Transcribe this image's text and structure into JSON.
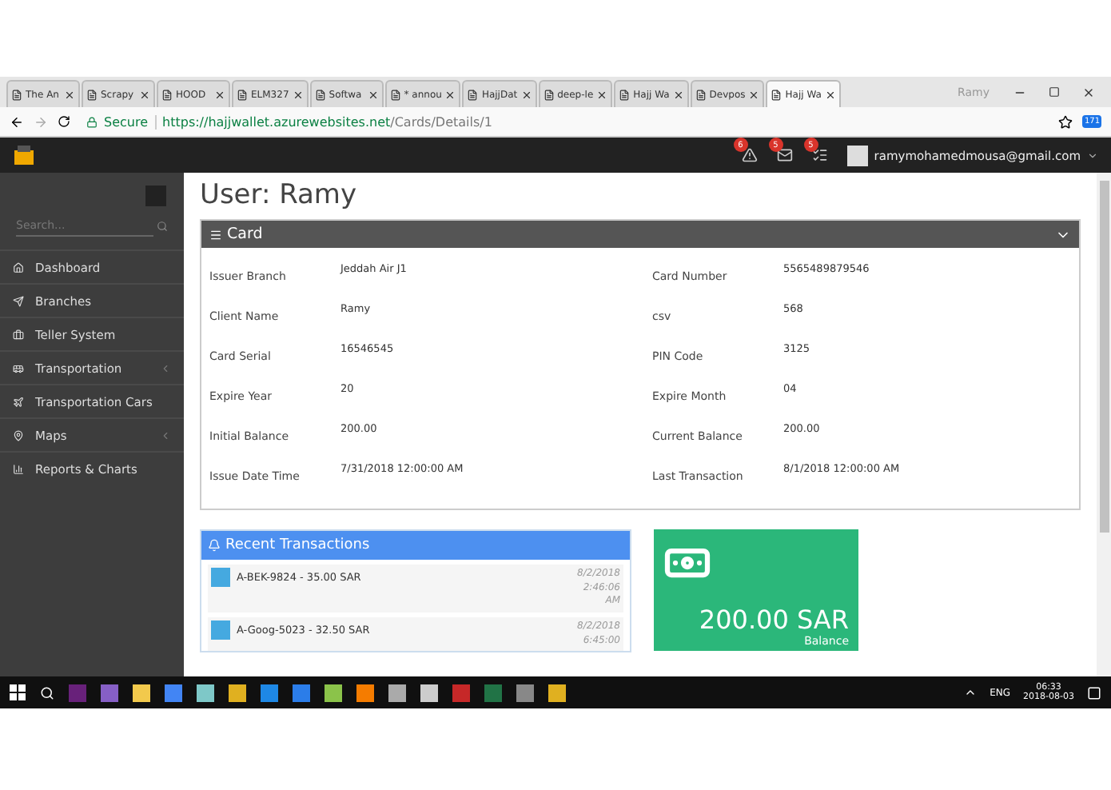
{
  "browser": {
    "tabs": [
      {
        "title": "The An",
        "selected": false
      },
      {
        "title": "Scrapy",
        "selected": false
      },
      {
        "title": "HOOD",
        "selected": false
      },
      {
        "title": "ELM327",
        "selected": false
      },
      {
        "title": "Softwa",
        "selected": false
      },
      {
        "title": "* annou",
        "selected": false
      },
      {
        "title": "HajjDat",
        "selected": false
      },
      {
        "title": "deep-le",
        "selected": false
      },
      {
        "title": "Hajj Wa",
        "selected": false
      },
      {
        "title": "Devpos",
        "selected": false
      },
      {
        "title": "Hajj Wa",
        "selected": true
      }
    ],
    "profile": "Ramy",
    "secure": "Secure",
    "url_host": "https://hajjwallet.azurewebsites.net",
    "url_path": "/Cards/Details/1",
    "extension_badge": "171"
  },
  "header": {
    "notifications": [
      {
        "kind": "alert",
        "count": "6"
      },
      {
        "kind": "mail",
        "count": "5"
      },
      {
        "kind": "tasks",
        "count": "5"
      }
    ],
    "user_email": "ramymohamedmousa@gmail.com"
  },
  "sidebar": {
    "search_placeholder": "Search...",
    "items": [
      {
        "label": "Dashboard",
        "has_submenu": false
      },
      {
        "label": "Branches",
        "has_submenu": false
      },
      {
        "label": "Teller System",
        "has_submenu": false
      },
      {
        "label": "Transportation",
        "has_submenu": true
      },
      {
        "label": "Transportation Cars",
        "has_submenu": false
      },
      {
        "label": "Maps",
        "has_submenu": true
      },
      {
        "label": "Reports & Charts",
        "has_submenu": false
      }
    ]
  },
  "page_title": "User: Ramy",
  "card_panel": {
    "title": "Card",
    "fields": [
      {
        "label": "Issuer Branch",
        "value": "Jeddah Air J1"
      },
      {
        "label": "Card Number",
        "value": "5565489879546"
      },
      {
        "label": "Client Name",
        "value": "Ramy"
      },
      {
        "label": "csv",
        "value": "568"
      },
      {
        "label": "Card Serial",
        "value": "16546545"
      },
      {
        "label": "PIN Code",
        "value": "3125"
      },
      {
        "label": "Expire Year",
        "value": "20"
      },
      {
        "label": "Expire Month",
        "value": "04"
      },
      {
        "label": "Initial Balance",
        "value": "200.00"
      },
      {
        "label": "Current Balance",
        "value": "200.00"
      },
      {
        "label": "Issue Date Time",
        "value": "7/31/2018 12:00:00 AM"
      },
      {
        "label": "Last Transaction",
        "value": "8/1/2018 12:00:00 AM"
      }
    ]
  },
  "recent_transactions": {
    "title": "Recent Transactions",
    "items": [
      {
        "text": "A-BEK-9824 - 35.00 SAR",
        "time": [
          "8/2/2018",
          "2:46:06",
          "AM"
        ]
      },
      {
        "text": "A-Goog-5023 - 32.50 SAR",
        "time": [
          "8/2/2018",
          "6:45:00"
        ]
      }
    ]
  },
  "balance_tile": {
    "amount": "200.00 SAR",
    "label": "Balance"
  },
  "taskbar": {
    "language": "ENG",
    "time": "06:33",
    "date": "2018-08-03"
  }
}
